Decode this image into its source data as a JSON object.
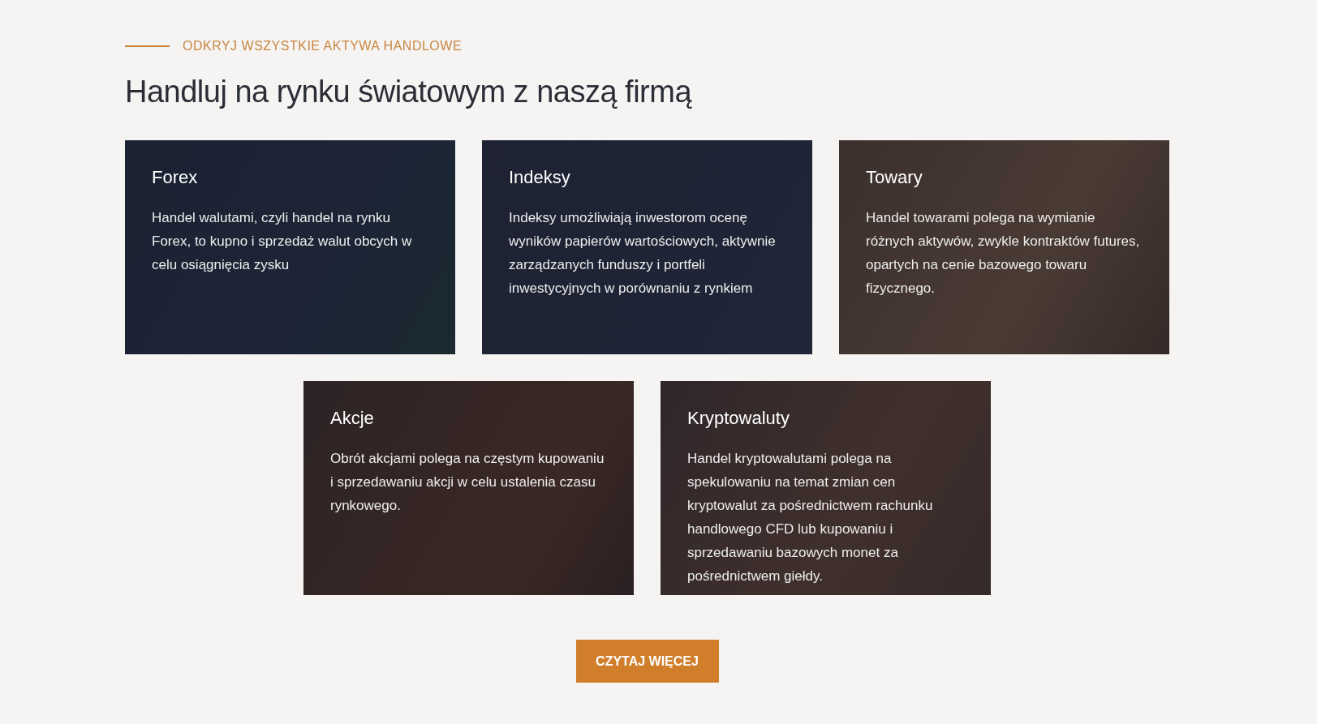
{
  "eyebrow": "ODKRYJ WSZYSTKIE AKTYWA HANDLOWE",
  "heading": "Handluj na rynku światowym z naszą firmą",
  "cards": [
    {
      "title": "Forex",
      "text": "Handel walutami, czyli handel na rynku Forex, to kupno i sprzedaż walut obcych w celu osiągnięcia zysku"
    },
    {
      "title": "Indeksy",
      "text": "Indeksy umożliwiają inwestorom ocenę wyników papierów wartościowych, aktywnie zarządzanych funduszy i portfeli inwestycyjnych w porównaniu z rynkiem"
    },
    {
      "title": "Towary",
      "text": "Handel towarami polega na wymianie różnych aktywów, zwykle kontraktów futures, opartych na cenie bazowego towaru fizycznego."
    },
    {
      "title": "Akcje",
      "text": "Obrót akcjami polega na częstym kupowaniu i sprzedawaniu akcji w celu ustalenia czasu rynkowego."
    },
    {
      "title": "Kryptowaluty",
      "text": "Handel kryptowalutami polega na spekulowaniu na temat zmian cen kryptowalut za pośrednictwem rachunku handlowego CFD lub kupowaniu i sprzedawaniu bazowych monet za pośrednictwem giełdy."
    }
  ],
  "button": "CZYTAJ WIĘCEJ"
}
